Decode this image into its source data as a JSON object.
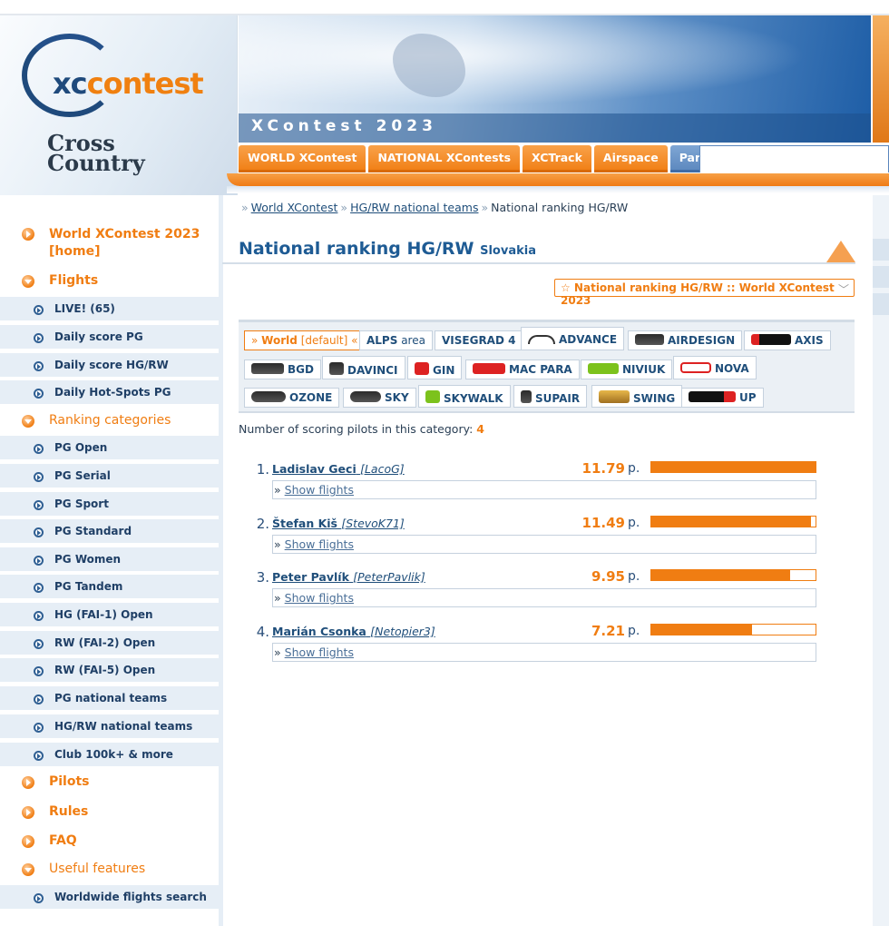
{
  "logo": {
    "xc_a": "xc",
    "xc_b": "contest",
    "cc_1": "Cross",
    "cc_2": "Country"
  },
  "banner": {
    "title": "XContest 2023"
  },
  "tabs": [
    "WORLD XContest",
    "NATIONAL XContests",
    "XCTrack",
    "Airspace",
    "Paramotors"
  ],
  "breadcrumb": {
    "items": [
      "World XContest",
      "HG/RW national teams"
    ],
    "current": "National ranking HG/RW",
    "sep": "»"
  },
  "heading": {
    "title": "National ranking HG/RW",
    "country": "Slovakia"
  },
  "selector": {
    "value": "☆ National ranking HG/RW :: World XContest 2023"
  },
  "sidebar": {
    "world": "World XContest 2023 [home]",
    "flights": "Flights",
    "flight_items": [
      "LIVE! (65)",
      "Daily score PG",
      "Daily score HG/RW",
      "Daily Hot-Spots PG"
    ],
    "ranking": "Ranking categories",
    "ranking_items": [
      "PG Open",
      "PG Serial",
      "PG Sport",
      "PG Standard",
      "PG Women",
      "PG Tandem",
      "HG (FAI-1) Open",
      "RW (FAI-2) Open",
      "RW (FAI-5) Open",
      "PG national teams",
      "HG/RW national teams",
      "Club 100k+ & more"
    ],
    "pilots": "Pilots",
    "rules": "Rules",
    "faq": "FAQ",
    "useful": "Useful features",
    "useful_items": [
      "Worldwide flights search"
    ]
  },
  "brands": {
    "world_a": "»",
    "world_b": "World",
    "world_c": "[default]",
    "world_d": "«",
    "alps_b": "ALPS",
    "alps_c": "area",
    "v4": "VISEGRAD 4",
    "list": [
      "ADVANCE",
      "AIRDESIGN",
      "AXIS",
      "BGD",
      "DAVINCI",
      "GIN",
      "MAC PARA",
      "NIVIUK",
      "NOVA",
      "OZONE",
      "SKY",
      "SKYWALK",
      "SUPAIR",
      "SWING",
      "UP"
    ]
  },
  "count": {
    "label": "Number of scoring pilots in this category:",
    "value": "4"
  },
  "pilots": [
    {
      "rank": "1.",
      "name": "Ladislav Geci",
      "nick": "[LacoG]",
      "score": "11.79",
      "unit": "p.",
      "fraction": 1.0,
      "show": "Show flights"
    },
    {
      "rank": "2.",
      "name": "Štefan Kiš",
      "nick": "[StevoK71]",
      "score": "11.49",
      "unit": "p.",
      "fraction": 0.975,
      "show": "Show flights"
    },
    {
      "rank": "3.",
      "name": "Peter Pavlík",
      "nick": "[PeterPavlik]",
      "score": "9.95",
      "unit": "p.",
      "fraction": 0.844,
      "show": "Show flights"
    },
    {
      "rank": "4.",
      "name": "Marián Csonka",
      "nick": "[Netopier3]",
      "score": "7.21",
      "unit": "p.",
      "fraction": 0.612,
      "show": "Show flights"
    }
  ],
  "show_prefix": "»"
}
